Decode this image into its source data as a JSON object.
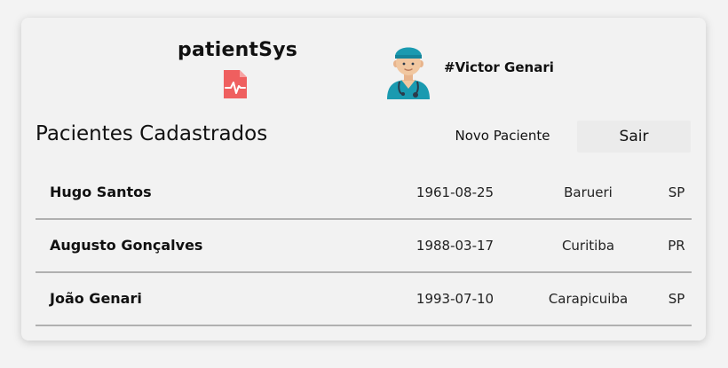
{
  "brand": {
    "name": "patientSys",
    "icon": "medical-record-icon"
  },
  "user": {
    "name": "#Victor Genari",
    "avatar": "doctor-avatar"
  },
  "page": {
    "title": "Pacientes Cadastrados"
  },
  "actions": {
    "new_patient": "Novo Paciente",
    "logout": "Sair"
  },
  "colors": {
    "accent": "#ef5f5f",
    "avatar_teal": "#1a9ab0",
    "row_border": "#b0b0b0"
  },
  "patients": [
    {
      "name": "Hugo Santos",
      "birth": "1961-08-25",
      "city": "Barueri",
      "state": "SP"
    },
    {
      "name": "Augusto Gonçalves",
      "birth": "1988-03-17",
      "city": "Curitiba",
      "state": "PR"
    },
    {
      "name": "João Genari",
      "birth": "1993-07-10",
      "city": "Carapicuiba",
      "state": "SP"
    }
  ]
}
